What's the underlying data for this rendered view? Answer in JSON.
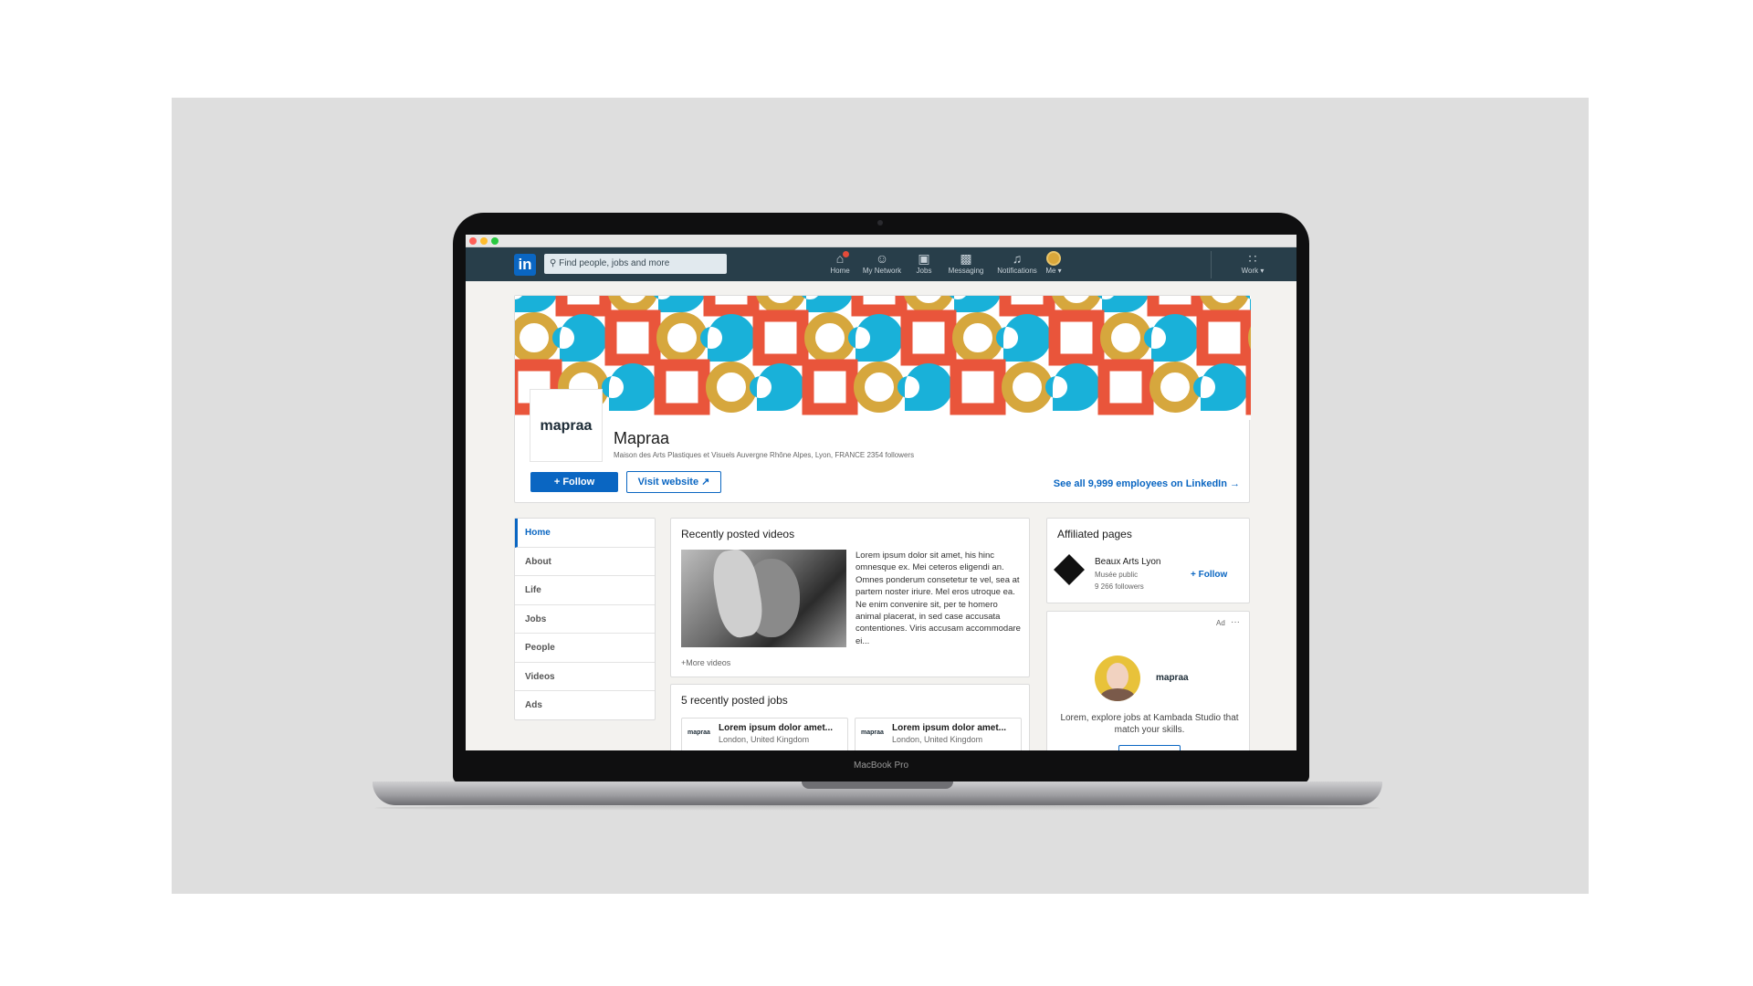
{
  "device": {
    "model_label": "MacBook Pro"
  },
  "nav": {
    "logo": "in",
    "search_placeholder": "Find people, jobs and more",
    "items": [
      {
        "label": "Home",
        "icon": "home-icon"
      },
      {
        "label": "My Network",
        "icon": "network-icon"
      },
      {
        "label": "Jobs",
        "icon": "briefcase-icon"
      },
      {
        "label": "Messaging",
        "icon": "messaging-icon"
      },
      {
        "label": "Notifications",
        "icon": "bell-icon"
      },
      {
        "label": "Me",
        "icon": "avatar"
      },
      {
        "label": "Work",
        "icon": "grid-icon"
      }
    ]
  },
  "company": {
    "logo_text": "mapraa",
    "name": "Mapraa",
    "subtitle": "Maison des Arts Plastiques et Visuels Auvergne Rhône Alpes, Lyon, FRANCE 2354 followers",
    "follow_label": "+ Follow",
    "visit_label": "Visit website",
    "see_all_label": "See all 9,999 employees on LinkedIn →"
  },
  "cover_colors": {
    "yellow": "#d6a73d",
    "blue": "#19b1d9",
    "red": "#e9553b"
  },
  "sidebar": {
    "items": [
      {
        "label": "Home",
        "active": true
      },
      {
        "label": "About",
        "active": false
      },
      {
        "label": "Life",
        "active": false
      },
      {
        "label": "Jobs",
        "active": false
      },
      {
        "label": "People",
        "active": false
      },
      {
        "label": "Videos",
        "active": false
      },
      {
        "label": "Ads",
        "active": false
      }
    ]
  },
  "videos": {
    "title": "Recently posted videos",
    "text": "Lorem ipsum dolor sit amet, his hinc omnesque ex. Mei ceteros eligendi an. Omnes ponderum consetetur te vel, sea at partem noster iriure. Mel eros utroque ea. Ne enim convenire sit, per te homero animal placerat, in sed case accusata contentiones. Viris accusam accommodare ei...",
    "more_label": "+More videos"
  },
  "jobs": {
    "title": "5 recently posted jobs",
    "items": [
      {
        "logo": "mapraa",
        "title": "Lorem ipsum dolor amet...",
        "location": "London, United Kingdom"
      },
      {
        "logo": "mapraa",
        "title": "Lorem ipsum dolor amet...",
        "location": "London, United Kingdom"
      }
    ]
  },
  "affiliated": {
    "title": "Affiliated pages",
    "name": "Beaux Arts Lyon",
    "type": "Musée public",
    "followers": "9 266 followers",
    "follow_label": "+ Follow"
  },
  "ad": {
    "label": "Ad",
    "more": "···",
    "brand": "mapraa",
    "text": "Lorem, explore jobs at Kambada Studio that match your skills."
  }
}
